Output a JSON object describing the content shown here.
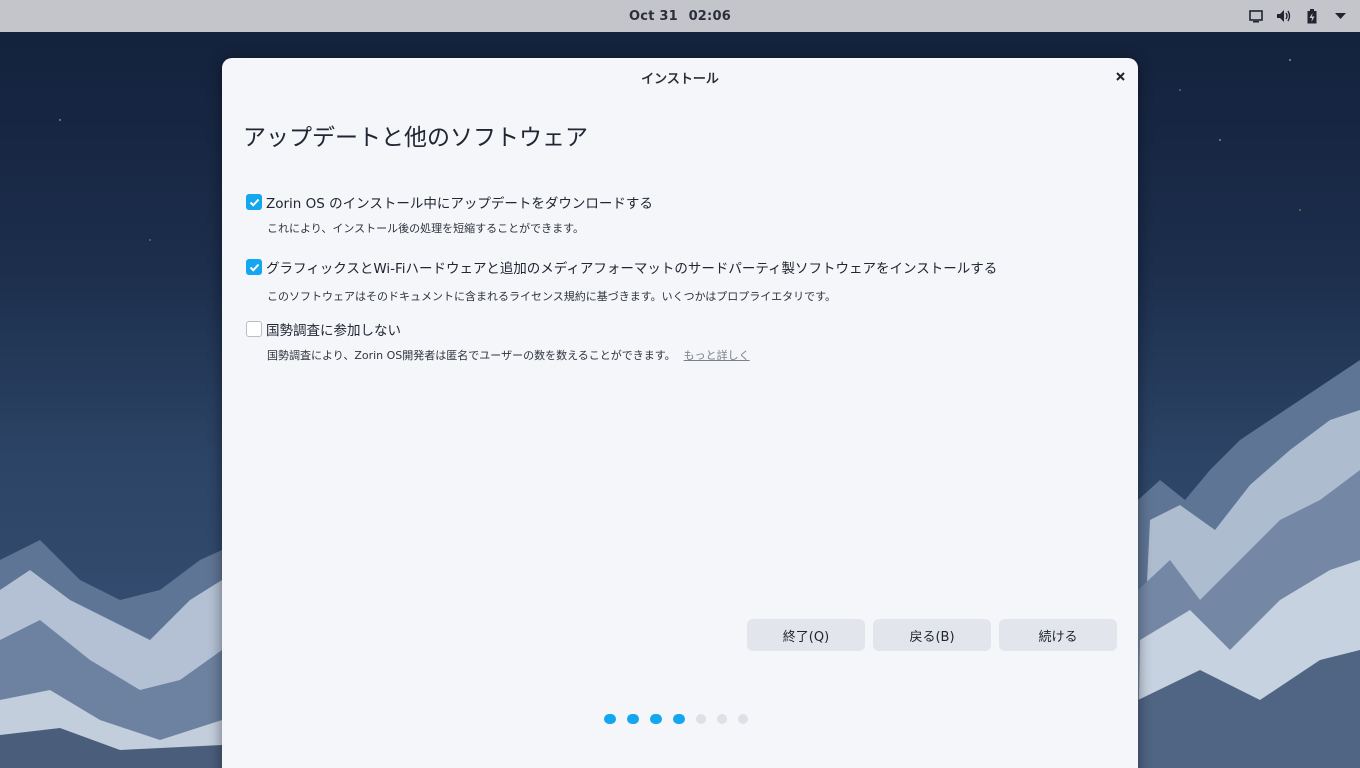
{
  "topbar": {
    "date": "Oct 31",
    "time": "02:06",
    "tray_icons": [
      "screen-icon",
      "volume-icon",
      "battery-icon",
      "dropdown-arrow-icon"
    ]
  },
  "dialog": {
    "title": "インストール",
    "heading": "アップデートと他のソフトウェア",
    "options": [
      {
        "label": "Zorin OS のインストール中にアップデートをダウンロードする",
        "description": "これにより、インストール後の処理を短縮することができます。",
        "checked": true
      },
      {
        "label": "グラフィックスとWi-Fiハードウェアと追加のメディアフォーマットのサードパーティ製ソフトウェアをインストールする",
        "description": "このソフトウェアはそのドキュメントに含まれるライセンス規約に基づきます。いくつかはプロプライエタリです。",
        "checked": true
      },
      {
        "label": "国勢調査に参加しない",
        "description": "国勢調査により、Zorin OS開発者は匿名でユーザーの数を数えることができます。",
        "link": "もっと詳しく",
        "checked": false
      }
    ],
    "buttons": {
      "quit": "終了(Q)",
      "back": "戻る(B)",
      "continue": "続ける"
    },
    "progress": {
      "total_steps": 7,
      "completed_steps": 4
    }
  },
  "colors": {
    "accent": "#15a6f0",
    "topbar": "#c3c5ca",
    "dialog_bg": "#f4f6fa",
    "button_bg": "#e2e5ec"
  }
}
